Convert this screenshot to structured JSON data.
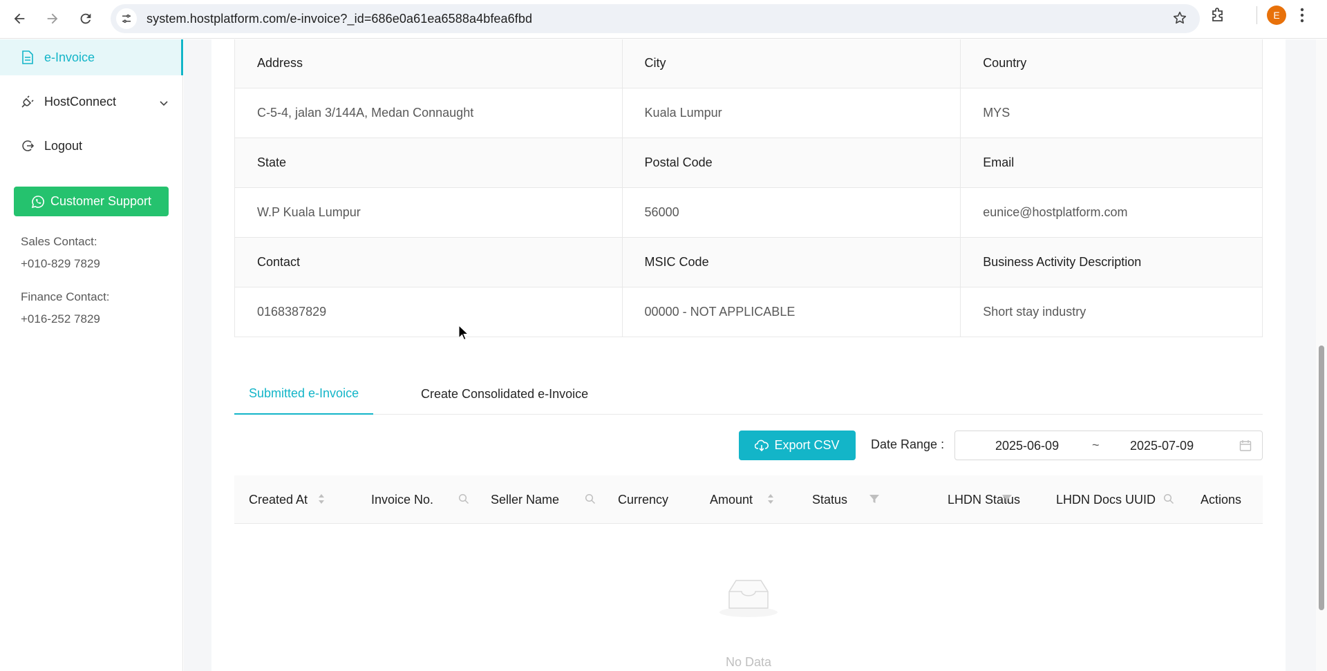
{
  "browser": {
    "url": "system.hostplatform.com/e-invoice?_id=686e0a61ea6588a4bfea6fbd",
    "profile_initial": "E"
  },
  "sidebar": {
    "items": [
      {
        "label": "e-Invoice",
        "icon": "document-icon",
        "active": true
      },
      {
        "label": "HostConnect",
        "icon": "plug-icon",
        "active": false
      },
      {
        "label": "Logout",
        "icon": "logout-icon",
        "active": false
      }
    ],
    "support_label": "Customer Support",
    "sales_contact_label": "Sales Contact:",
    "sales_contact_value": "+010-829 7829",
    "finance_contact_label": "Finance Contact:",
    "finance_contact_value": "+016-252 7829"
  },
  "details": {
    "rows": [
      {
        "type": "label",
        "cells": [
          "Address",
          "City",
          "Country"
        ]
      },
      {
        "type": "value",
        "cells": [
          "C-5-4, jalan 3/144A, Medan Connaught",
          "Kuala Lumpur",
          "MYS"
        ]
      },
      {
        "type": "label",
        "cells": [
          "State",
          "Postal Code",
          "Email"
        ]
      },
      {
        "type": "value",
        "cells": [
          "W.P Kuala Lumpur",
          "56000",
          "eunice@hostplatform.com"
        ]
      },
      {
        "type": "label",
        "cells": [
          "Contact",
          "MSIC Code",
          "Business Activity Description"
        ]
      },
      {
        "type": "value",
        "cells": [
          "0168387829",
          "00000 - NOT APPLICABLE",
          "Short stay industry"
        ]
      }
    ]
  },
  "tabs": {
    "submitted": "Submitted e-Invoice",
    "consolidated": "Create Consolidated e-Invoice"
  },
  "toolbar": {
    "export_label": "Export CSV",
    "date_range_label": "Date Range :",
    "date_from": "2025-06-09",
    "date_separator": "~",
    "date_to": "2025-07-09"
  },
  "table": {
    "columns": {
      "created_at": "Created At",
      "invoice_no": "Invoice No.",
      "seller_name": "Seller Name",
      "currency": "Currency",
      "amount": "Amount",
      "status": "Status",
      "lhdn_status": "LHDN Status",
      "lhdn_docs_uuid": "LHDN Docs UUID",
      "actions": "Actions"
    },
    "empty_text": "No Data"
  },
  "colors": {
    "accent": "#13b5c8",
    "support_green": "#25c26e"
  }
}
